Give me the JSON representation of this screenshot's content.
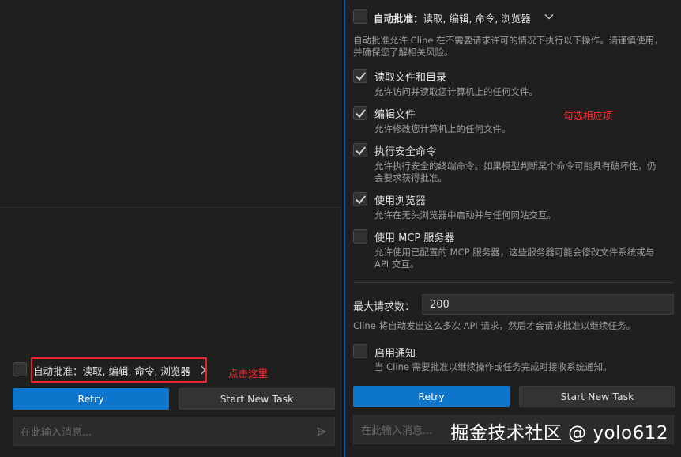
{
  "left": {
    "auto_approve_label": "自动批准：",
    "auto_approve_summary": "读取, 编辑, 命令, 浏览器",
    "annotation": "点击这里",
    "retry": "Retry",
    "start_new_task": "Start New Task",
    "input_placeholder": "在此输入消息..."
  },
  "right": {
    "header_label": "自动批准：",
    "header_summary": "读取, 编辑, 命令, 浏览器",
    "intro": [
      "自动批准允许 Cline 在不需要请求许可的情况下执行以下操作。请谨慎使用，",
      "并确保您了解相关风险。"
    ],
    "options": [
      {
        "title": "读取文件和目录",
        "checked": true,
        "desc": [
          "允许访问并读取您计算机上的任何文件。"
        ]
      },
      {
        "title": "编辑文件",
        "checked": true,
        "desc": [
          "允许修改您计算机上的任何文件。"
        ]
      },
      {
        "title": "执行安全命令",
        "checked": true,
        "desc": [
          "允许执行安全的终端命令。如果模型判断某个命令可能具有破坏性，仍",
          "会要求获得批准。"
        ]
      },
      {
        "title": "使用浏览器",
        "checked": true,
        "desc": [
          "允许在无头浏览器中启动并与任何网站交互。"
        ]
      },
      {
        "title": "使用 MCP 服务器",
        "checked": false,
        "desc": [
          "允许使用已配置的 MCP 服务器，这些服务器可能会修改文件系统或与",
          "API 交互。"
        ]
      }
    ],
    "annotation": "勾选相应项",
    "max_requests_label": "最大请求数：",
    "max_requests_value": "200",
    "max_requests_desc": "Cline 将自动发出这么多次 API 请求，然后才会请求批准以继续任务。",
    "notify_title": "启用通知",
    "notify_checked": false,
    "notify_desc": "当 Cline 需要批准以继续操作或任务完成时接收系统通知。",
    "retry": "Retry",
    "start_new_task": "Start New Task",
    "input_placeholder": "在此输入消息...",
    "watermark": "掘金技术社区 @ yolo612"
  }
}
